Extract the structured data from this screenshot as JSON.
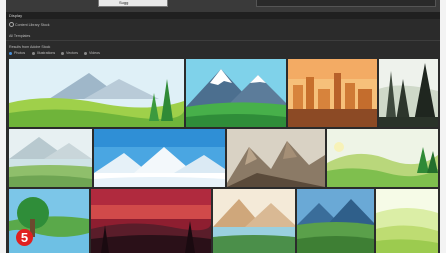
{
  "toolbar": {
    "search_value": "Sugg"
  },
  "panel": {
    "title": "Display",
    "search_placeholder": "Content Library Stock",
    "section_label": "All Templates",
    "filter_label": "Results from Adobe Stock",
    "filters": [
      {
        "label": "Photos",
        "selected": true
      },
      {
        "label": "Illustrations",
        "selected": false
      },
      {
        "label": "Vectors",
        "selected": false
      },
      {
        "label": "Videos",
        "selected": false
      }
    ]
  },
  "thumbnails": [
    {
      "name": "thumb-meadow-mountains"
    },
    {
      "name": "thumb-snowy-peaks"
    },
    {
      "name": "thumb-desert-city"
    },
    {
      "name": "thumb-forest-silhouette"
    },
    {
      "name": "thumb-mountain-lake"
    },
    {
      "name": "thumb-winter-peaks"
    },
    {
      "name": "thumb-rocky-mountains"
    },
    {
      "name": "thumb-green-hills"
    },
    {
      "name": "thumb-river-tree"
    },
    {
      "name": "thumb-sunset-forest"
    },
    {
      "name": "thumb-lake-valley"
    },
    {
      "name": "thumb-mountain-meadow"
    },
    {
      "name": "thumb-green-glow"
    }
  ],
  "badge": {
    "label": "5",
    "color": "#e02020"
  }
}
